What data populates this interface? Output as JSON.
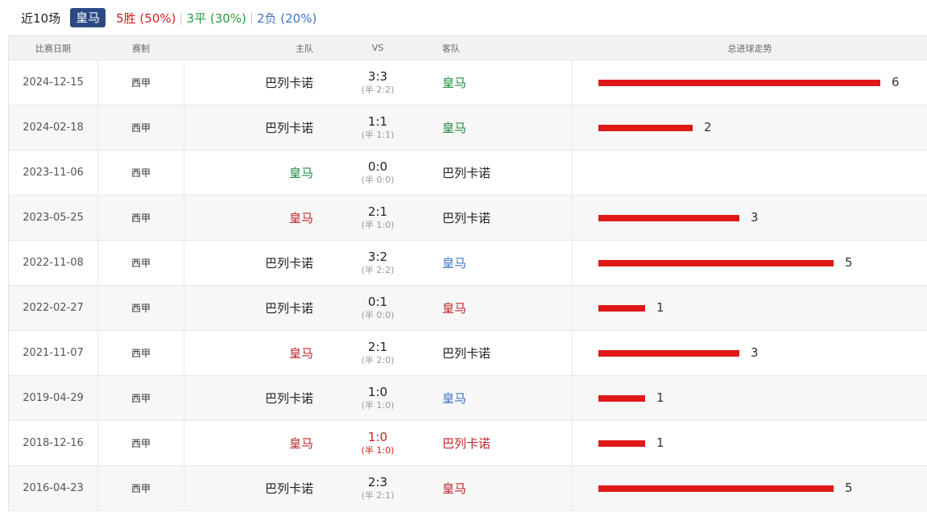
{
  "header": {
    "recent_label": "近10场",
    "team_tag": "皇马",
    "win_text": "5胜 (50%)",
    "separator": "|",
    "draw_text": "3平 (30%)",
    "loss_text": "2负 (20%)"
  },
  "columns": {
    "date": "比赛日期",
    "competition": "赛制",
    "home": "主队",
    "vs": "VS",
    "away": "客队",
    "trend": "总进球走势"
  },
  "colors": {
    "win": "#d21e1e",
    "draw": "#2a9a3e",
    "loss": "#3b76c4",
    "bar": "#e01818",
    "tag": "#2b4a84"
  },
  "max_goals": 6,
  "matches": [
    {
      "date": "2024-12-15",
      "comp": "西甲",
      "home": "巴列卡诺",
      "home_color": "",
      "score": "3:3",
      "half": "(半 2:2)",
      "score_color": "",
      "away": "皇马",
      "away_color": "green",
      "total_goals": 6,
      "total_label": "6"
    },
    {
      "date": "2024-02-18",
      "comp": "西甲",
      "home": "巴列卡诺",
      "home_color": "",
      "score": "1:1",
      "half": "(半 1:1)",
      "score_color": "",
      "away": "皇马",
      "away_color": "green",
      "total_goals": 2,
      "total_label": "2"
    },
    {
      "date": "2023-11-06",
      "comp": "西甲",
      "home": "皇马",
      "home_color": "green",
      "score": "0:0",
      "half": "(半 0:0)",
      "score_color": "",
      "away": "巴列卡诺",
      "away_color": "",
      "total_goals": 0,
      "total_label": ""
    },
    {
      "date": "2023-05-25",
      "comp": "西甲",
      "home": "皇马",
      "home_color": "red",
      "score": "2:1",
      "half": "(半 1:0)",
      "score_color": "",
      "away": "巴列卡诺",
      "away_color": "",
      "total_goals": 3,
      "total_label": "3"
    },
    {
      "date": "2022-11-08",
      "comp": "西甲",
      "home": "巴列卡诺",
      "home_color": "",
      "score": "3:2",
      "half": "(半 2:2)",
      "score_color": "",
      "away": "皇马",
      "away_color": "blue",
      "total_goals": 5,
      "total_label": "5"
    },
    {
      "date": "2022-02-27",
      "comp": "西甲",
      "home": "巴列卡诺",
      "home_color": "",
      "score": "0:1",
      "half": "(半 0:0)",
      "score_color": "",
      "away": "皇马",
      "away_color": "red",
      "total_goals": 1,
      "total_label": "1"
    },
    {
      "date": "2021-11-07",
      "comp": "西甲",
      "home": "皇马",
      "home_color": "red",
      "score": "2:1",
      "half": "(半 2:0)",
      "score_color": "",
      "away": "巴列卡诺",
      "away_color": "",
      "total_goals": 3,
      "total_label": "3"
    },
    {
      "date": "2019-04-29",
      "comp": "西甲",
      "home": "巴列卡诺",
      "home_color": "",
      "score": "1:0",
      "half": "(半 1:0)",
      "score_color": "",
      "away": "皇马",
      "away_color": "blue",
      "total_goals": 1,
      "total_label": "1"
    },
    {
      "date": "2018-12-16",
      "comp": "西甲",
      "home": "皇马",
      "home_color": "red",
      "score": "1:0",
      "half": "(半 1:0)",
      "score_color": "red",
      "away": "巴列卡诺",
      "away_color": "red",
      "total_goals": 1,
      "total_label": "1"
    },
    {
      "date": "2016-04-23",
      "comp": "西甲",
      "home": "巴列卡诺",
      "home_color": "",
      "score": "2:3",
      "half": "(半 2:1)",
      "score_color": "",
      "away": "皇马",
      "away_color": "red",
      "total_goals": 5,
      "total_label": "5"
    }
  ]
}
